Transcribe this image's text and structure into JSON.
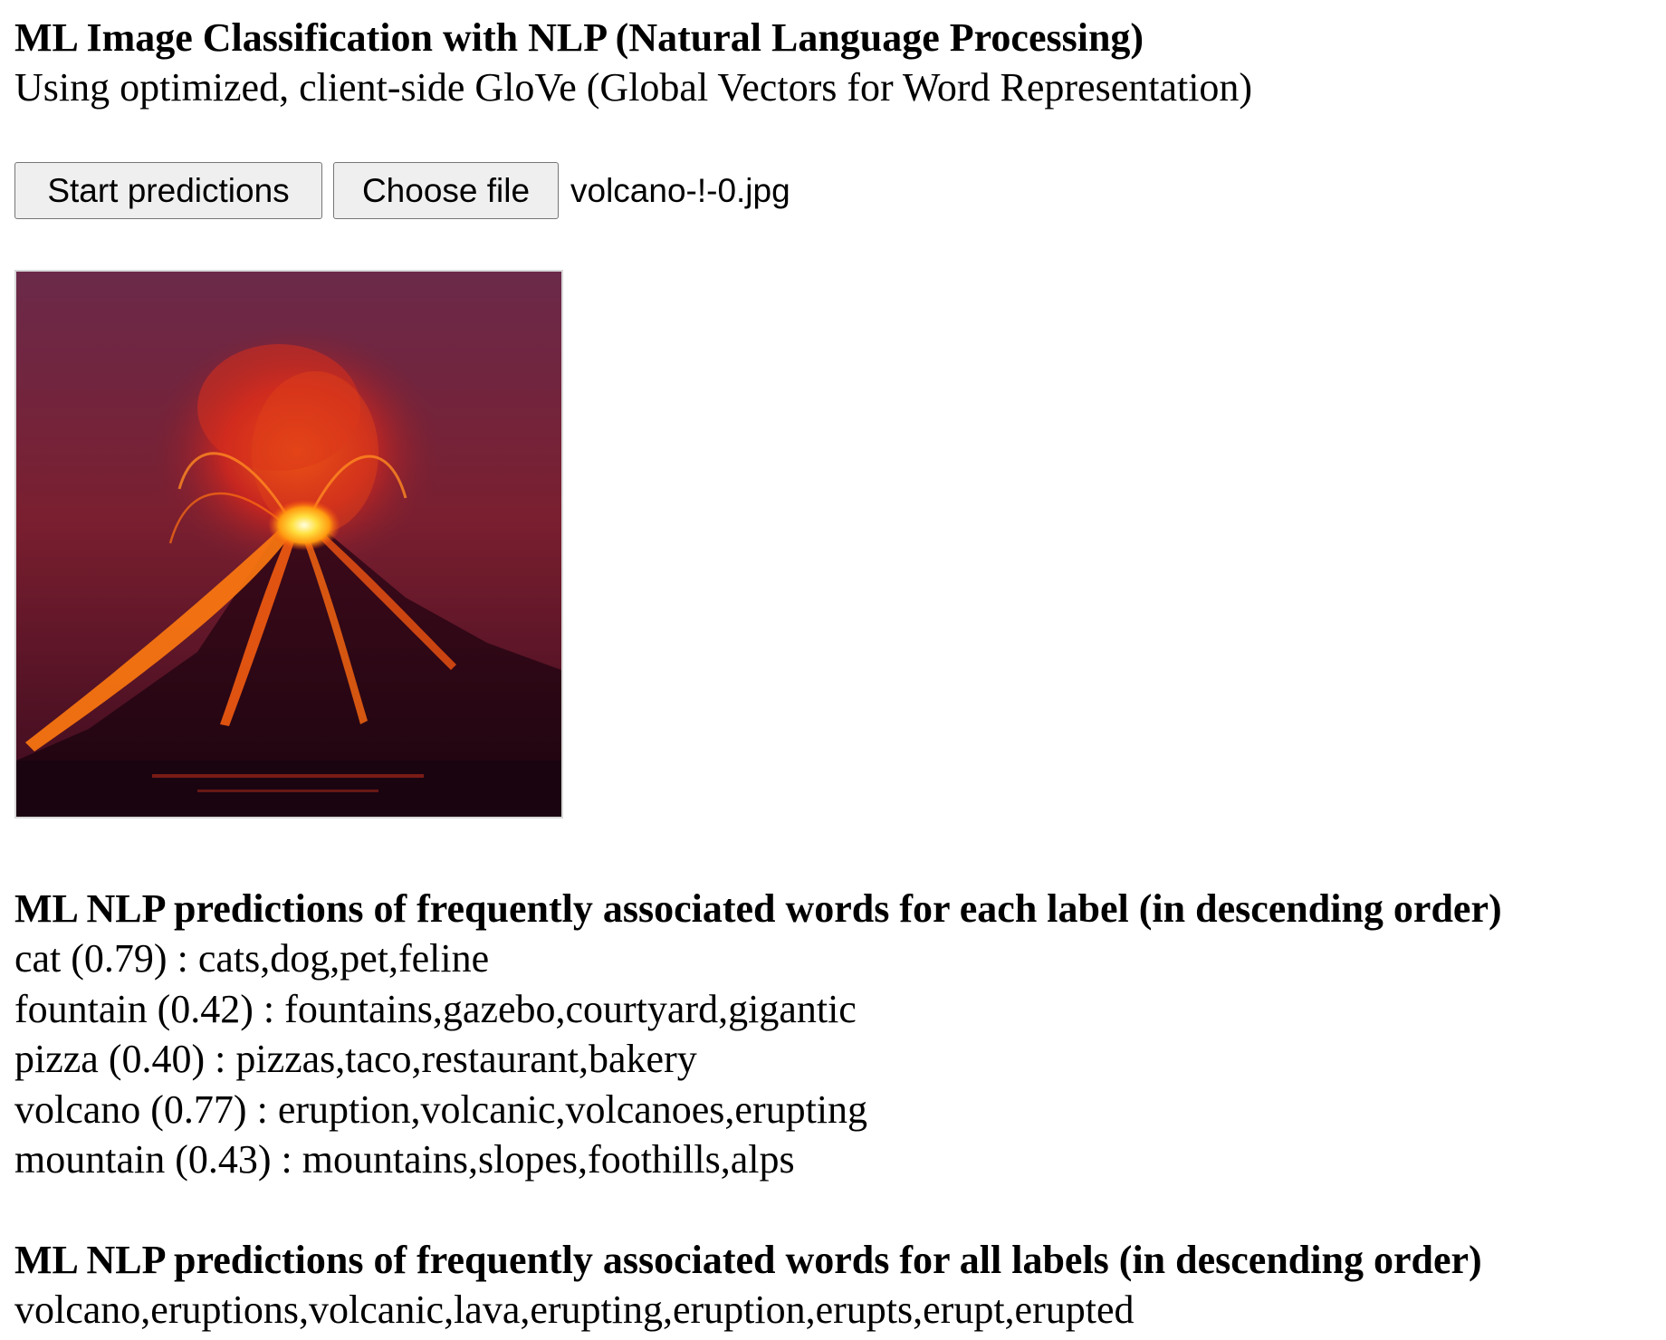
{
  "header": {
    "title": "ML Image Classification with NLP (Natural Language Processing)",
    "subtitle": "Using optimized, client-side GloVe (Global Vectors for Word Representation)"
  },
  "controls": {
    "start_label": "Start predictions",
    "choose_file_label": "Choose file",
    "file_name": "volcano-!-0.jpg"
  },
  "per_label": {
    "heading": "ML NLP predictions of frequently associated words for each label (in descending order)",
    "items": [
      {
        "text": "cat (0.79) : cats,dog,pet,feline"
      },
      {
        "text": "fountain (0.42) : fountains,gazebo,courtyard,gigantic"
      },
      {
        "text": "pizza (0.40) : pizzas,taco,restaurant,bakery"
      },
      {
        "text": "volcano (0.77) : eruption,volcanic,volcanoes,erupting"
      },
      {
        "text": "mountain (0.43) : mountains,slopes,foothills,alps"
      }
    ]
  },
  "all_labels": {
    "heading": "ML NLP predictions of frequently associated words for all labels (in descending order)",
    "words": "volcano,eruptions,volcanic,lava,erupting,eruption,erupts,erupt,erupted"
  }
}
